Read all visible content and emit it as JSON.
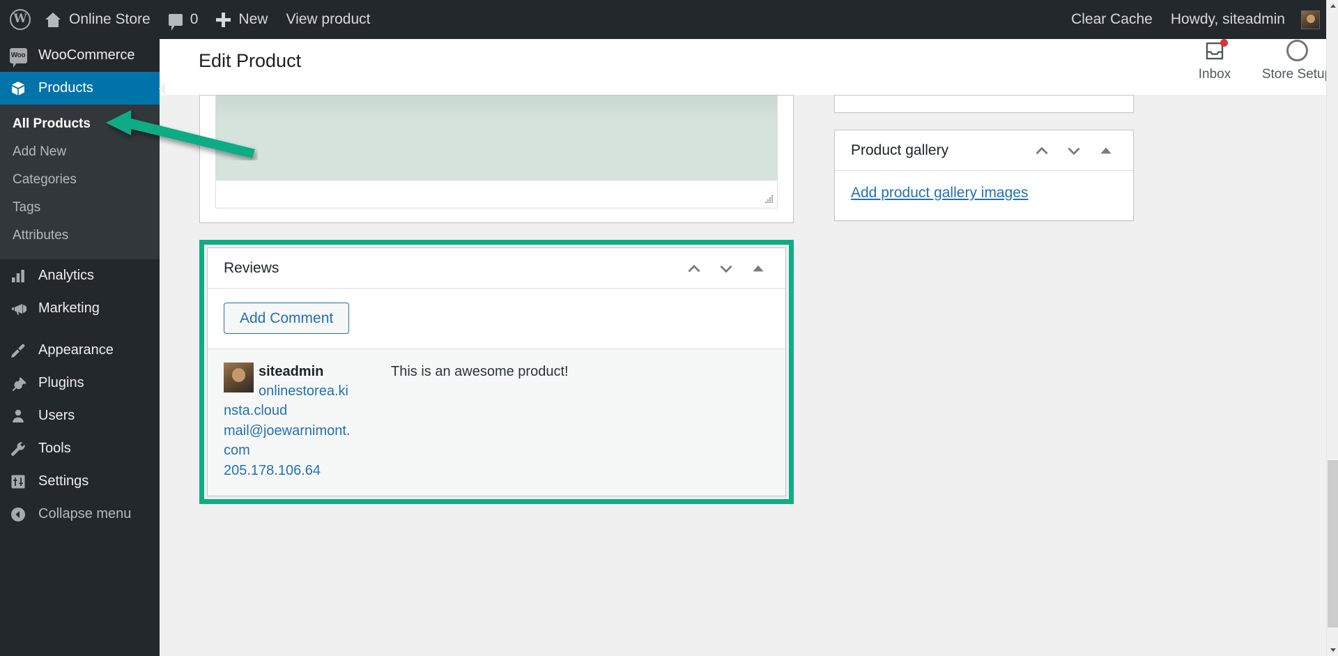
{
  "adminbar": {
    "wp_logo": "wordpress-logo",
    "site_name": "Online Store",
    "comments_count": "0",
    "new_label": "New",
    "view_product_label": "View product",
    "clear_cache_label": "Clear Cache",
    "howdy_label": "Howdy, siteadmin"
  },
  "sidebar": {
    "woocommerce_label": "WooCommerce",
    "products_label": "Products",
    "products_submenu": [
      {
        "label": "All Products",
        "active": true
      },
      {
        "label": "Add New",
        "active": false
      },
      {
        "label": "Categories",
        "active": false
      },
      {
        "label": "Tags",
        "active": false
      },
      {
        "label": "Attributes",
        "active": false
      }
    ],
    "items": [
      {
        "label": "Analytics",
        "icon": "chart-bar-icon"
      },
      {
        "label": "Marketing",
        "icon": "megaphone-icon"
      },
      {
        "label": "Appearance",
        "icon": "paintbrush-icon"
      },
      {
        "label": "Plugins",
        "icon": "plug-icon"
      },
      {
        "label": "Users",
        "icon": "user-icon"
      },
      {
        "label": "Tools",
        "icon": "wrench-icon"
      },
      {
        "label": "Settings",
        "icon": "sliders-icon"
      }
    ],
    "collapse_label": "Collapse menu"
  },
  "header": {
    "title": "Edit Product",
    "inbox_label": "Inbox",
    "store_setup_label": "Store Setup"
  },
  "reviews_panel": {
    "title": "Reviews",
    "add_comment_label": "Add Comment",
    "review": {
      "author": "siteadmin",
      "site": "onlinestorea.kinsta.cloud",
      "email": "mail@joewarnimont.com",
      "ip": "205.178.106.64",
      "comment": "This is an awesome product!"
    }
  },
  "gallery_panel": {
    "title": "Product gallery",
    "add_images_label": "Add product gallery images"
  },
  "colors": {
    "highlight_green": "#10ac84",
    "wp_blue": "#2271b1",
    "menu_current": "#0073aa",
    "admin_dark": "#23282d",
    "notification_red": "#d63638"
  },
  "annotation": {
    "arrow": "green-arrow-pointing-to-all-products"
  }
}
